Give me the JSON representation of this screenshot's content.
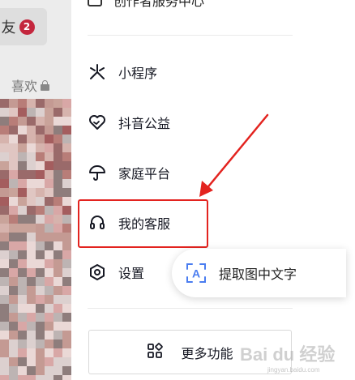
{
  "left": {
    "friend_tab": "友",
    "friend_badge": "2",
    "likes_tab": "喜欢"
  },
  "drawer": {
    "top_item": "创作者服务中心",
    "items": [
      {
        "label": "小程序",
        "icon": "mini-program-icon"
      },
      {
        "label": "抖音公益",
        "icon": "charity-heart-icon"
      },
      {
        "label": "家庭平台",
        "icon": "umbrella-icon"
      },
      {
        "label": "我的客服",
        "icon": "headset-icon"
      },
      {
        "label": "设置",
        "icon": "settings-hexagon-icon"
      }
    ],
    "more_button": "更多功能"
  },
  "ocr_popup": {
    "label": "提取图中文字",
    "icon": "text-recognition-icon",
    "icon_letter": "A"
  },
  "annotation": {
    "color": "#e3231f"
  },
  "watermark": {
    "text": "Bai du 经验",
    "sub": "jingyan.baidu.com"
  },
  "colors": {
    "accent_red": "#e3231f",
    "badge_red": "#c4263d",
    "ocr_blue": "#4a7df0"
  }
}
